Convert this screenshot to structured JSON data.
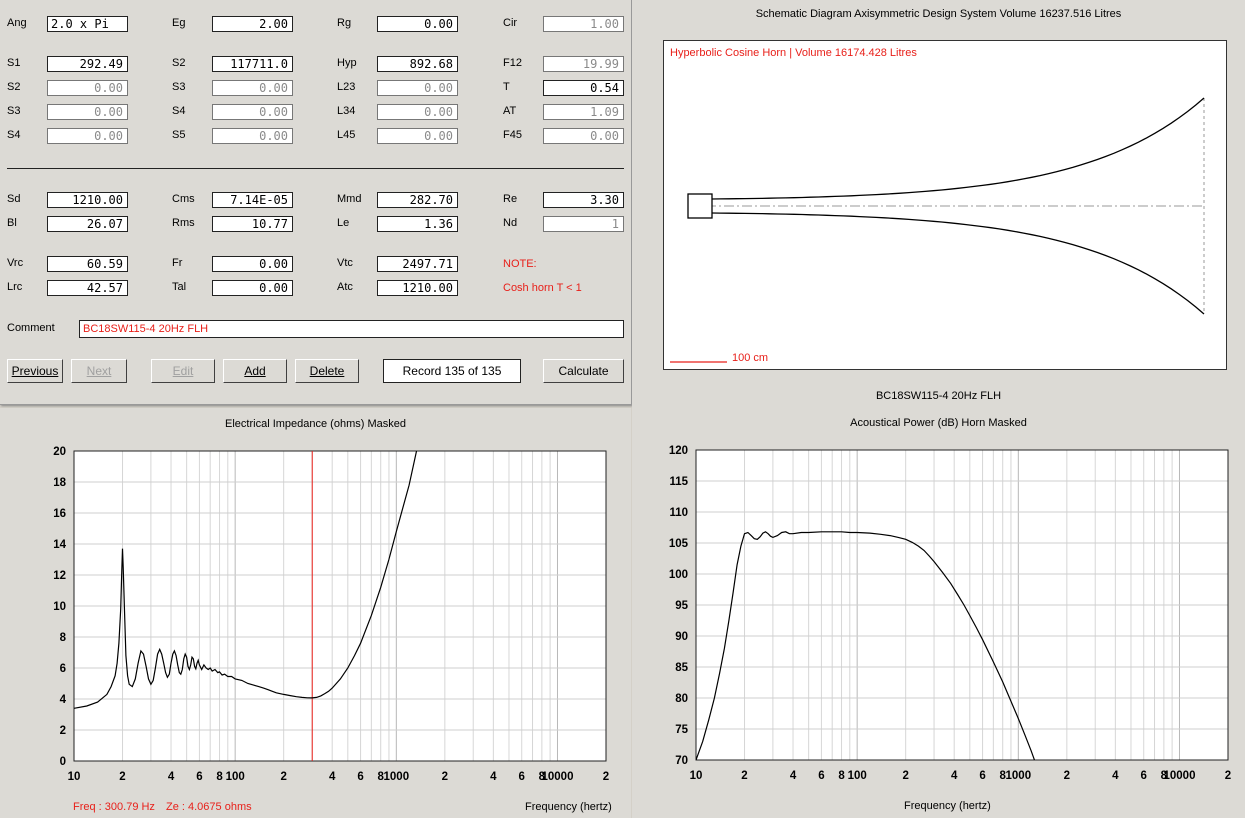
{
  "inputs": {
    "row1": [
      {
        "label": "Ang",
        "value": "2.0 x Pi",
        "align": "l",
        "dim": false
      },
      {
        "label": "Eg",
        "value": "2.00",
        "align": "r",
        "dim": false
      },
      {
        "label": "Rg",
        "value": "0.00",
        "align": "r",
        "dim": false
      },
      {
        "label": "Cir",
        "value": "1.00",
        "align": "r",
        "dim": true
      }
    ],
    "row2": [
      {
        "label": "S1",
        "value": "292.49",
        "dim": false
      },
      {
        "label": "S2",
        "value": "117711.0",
        "dim": false
      },
      {
        "label": "Hyp",
        "value": "892.68",
        "dim": false
      },
      {
        "label": "F12",
        "value": "19.99",
        "dim": true
      }
    ],
    "row3": [
      {
        "label": "S2",
        "value": "0.00",
        "dim": true
      },
      {
        "label": "S3",
        "value": "0.00",
        "dim": true
      },
      {
        "label": "L23",
        "value": "0.00",
        "dim": true
      },
      {
        "label": "T",
        "value": "0.54",
        "dim": false
      }
    ],
    "row4": [
      {
        "label": "S3",
        "value": "0.00",
        "dim": true
      },
      {
        "label": "S4",
        "value": "0.00",
        "dim": true
      },
      {
        "label": "L34",
        "value": "0.00",
        "dim": true
      },
      {
        "label": "AT",
        "value": "1.09",
        "dim": true
      }
    ],
    "row5": [
      {
        "label": "S4",
        "value": "0.00",
        "dim": true
      },
      {
        "label": "S5",
        "value": "0.00",
        "dim": true
      },
      {
        "label": "L45",
        "value": "0.00",
        "dim": true
      },
      {
        "label": "F45",
        "value": "0.00",
        "dim": true
      }
    ],
    "row6": [
      {
        "label": "Sd",
        "value": "1210.00",
        "dim": false
      },
      {
        "label": "Cms",
        "value": "7.14E-05",
        "dim": false
      },
      {
        "label": "Mmd",
        "value": "282.70",
        "dim": false
      },
      {
        "label": "Re",
        "value": "3.30",
        "dim": false
      }
    ],
    "row7": [
      {
        "label": "Bl",
        "value": "26.07",
        "dim": false
      },
      {
        "label": "Rms",
        "value": "10.77",
        "dim": false
      },
      {
        "label": "Le",
        "value": "1.36",
        "dim": false
      },
      {
        "label": "Nd",
        "value": "1",
        "dim": true
      }
    ],
    "row8": [
      {
        "label": "Vrc",
        "value": "60.59",
        "dim": false
      },
      {
        "label": "Fr",
        "value": "0.00",
        "dim": false
      },
      {
        "label": "Vtc",
        "value": "2497.71",
        "dim": false
      }
    ],
    "row9": [
      {
        "label": "Lrc",
        "value": "42.57",
        "dim": false
      },
      {
        "label": "Tal",
        "value": "0.00",
        "dim": false
      },
      {
        "label": "Atc",
        "value": "1210.00",
        "dim": false
      }
    ],
    "note_label": "NOTE:",
    "note_text": "Cosh horn  T < 1",
    "comment_label": "Comment",
    "comment_value": "BC18SW115-4  20Hz FLH",
    "buttons": {
      "previous": "Previous",
      "next": "Next",
      "edit": "Edit",
      "add": "Add",
      "delete": "Delete",
      "record": "Record 135 of 135",
      "calculate": "Calculate"
    }
  },
  "schematic": {
    "title": "Schematic Diagram   Axisymmetric Design   System Volume 16237.516 Litres",
    "horn_label": "Hyperbolic Cosine Horn | Volume 16174.428 Litres",
    "scale_label": "100 cm",
    "caption": "BC18SW115-4  20Hz FLH"
  },
  "impedance": {
    "title": "Electrical Impedance (ohms)   Masked",
    "readout_freq": "Freq : 300.79 Hz",
    "readout_ze": "Ze : 4.0675 ohms",
    "xlabel": "Frequency (hertz)"
  },
  "power": {
    "title": "Acoustical Power (dB)   Horn   Masked",
    "xlabel": "Frequency (hertz)"
  },
  "colors": {
    "curve": "#000000",
    "cursor": "#e8201a",
    "grid": "#c8c8c8",
    "note": "#e8201a"
  },
  "chart_data": [
    {
      "type": "line",
      "title": "Electrical Impedance (ohms)   Masked",
      "xlabel": "Frequency (hertz)",
      "ylabel": "",
      "xscale": "log",
      "xlim": [
        10,
        20000
      ],
      "ylim": [
        0,
        20
      ],
      "yticks": [
        0,
        2,
        4,
        6,
        8,
        10,
        12,
        14,
        16,
        18,
        20
      ],
      "xtick_labels": [
        "10",
        "2",
        "4",
        "6",
        "8",
        "100",
        "2",
        "4",
        "6",
        "8",
        "1000",
        "2",
        "4",
        "6",
        "8",
        "10000",
        "2"
      ],
      "cursor_x": 300.79,
      "series": [
        {
          "x": [
            10,
            12,
            14,
            16,
            17,
            18,
            18.5,
            19,
            19.5,
            19.8,
            20,
            20.2,
            20.6,
            21,
            21.5,
            22,
            23,
            24,
            25,
            26,
            27,
            28,
            29,
            30,
            31,
            32,
            33,
            34,
            35,
            36,
            37,
            38,
            39,
            40,
            41,
            42,
            43,
            44,
            45,
            46,
            47,
            48,
            49,
            50,
            51,
            52,
            53,
            54,
            55,
            56,
            57,
            58,
            59,
            60,
            62,
            64,
            66,
            68,
            70,
            72,
            75,
            78,
            80,
            83,
            86,
            90,
            95,
            100,
            110,
            120,
            130,
            140,
            150,
            160,
            170,
            180,
            200,
            220,
            240,
            260,
            280,
            300,
            320,
            340,
            360,
            380,
            400,
            450,
            500,
            550,
            600,
            700,
            800,
            900,
            1000,
            1200,
            1400,
            1600,
            1800,
            2000,
            2200,
            2400
          ],
          "y": [
            3.4,
            3.55,
            3.8,
            4.3,
            4.8,
            5.5,
            6.3,
            7.6,
            9.8,
            12.3,
            13.7,
            12.5,
            9.5,
            6.8,
            5.5,
            4.95,
            4.8,
            5.3,
            6.3,
            7.1,
            6.9,
            6.1,
            5.3,
            4.95,
            5.2,
            6.0,
            6.9,
            7.2,
            6.9,
            6.3,
            5.7,
            5.4,
            5.6,
            6.3,
            6.9,
            7.1,
            6.8,
            6.2,
            5.7,
            5.6,
            5.9,
            6.6,
            6.9,
            6.7,
            6.1,
            5.9,
            6.2,
            6.7,
            6.6,
            6.1,
            5.95,
            6.3,
            6.5,
            6.2,
            5.9,
            6.2,
            6.0,
            5.9,
            6.0,
            5.8,
            5.9,
            5.7,
            5.75,
            5.55,
            5.6,
            5.45,
            5.45,
            5.3,
            5.2,
            5.0,
            4.9,
            4.8,
            4.7,
            4.6,
            4.5,
            4.4,
            4.3,
            4.22,
            4.15,
            4.1,
            4.08,
            4.07,
            4.1,
            4.2,
            4.35,
            4.5,
            4.7,
            5.3,
            6.0,
            6.8,
            7.6,
            9.4,
            11.2,
            13.0,
            14.8,
            17.8,
            21.0,
            24.0,
            27.0,
            30.0,
            33.0,
            36.0
          ],
          "color": "#000000"
        }
      ]
    },
    {
      "type": "line",
      "title": "Acoustical Power (dB)   Horn   Masked",
      "xlabel": "Frequency (hertz)",
      "ylabel": "",
      "xscale": "log",
      "xlim": [
        10,
        20000
      ],
      "ylim": [
        70,
        120
      ],
      "yticks": [
        70,
        75,
        80,
        85,
        90,
        95,
        100,
        105,
        110,
        115,
        120
      ],
      "xtick_labels": [
        "10",
        "2",
        "4",
        "6",
        "8",
        "100",
        "2",
        "4",
        "6",
        "8",
        "1000",
        "2",
        "4",
        "6",
        "8",
        "10000",
        "2"
      ],
      "series": [
        {
          "x": [
            10,
            11,
            12,
            13,
            14,
            15,
            16,
            17,
            18,
            19,
            20,
            21,
            22,
            23,
            24,
            25,
            26,
            27,
            28,
            29,
            30,
            32,
            34,
            36,
            38,
            40,
            45,
            50,
            60,
            70,
            80,
            90,
            100,
            120,
            140,
            160,
            180,
            200,
            220,
            240,
            260,
            280,
            300,
            340,
            380,
            420,
            460,
            500,
            550,
            600,
            700,
            800,
            900,
            1000,
            1100,
            1200,
            1300
          ],
          "y": [
            70,
            73,
            76.5,
            80,
            84,
            88,
            92.5,
            97,
            101.5,
            104.5,
            106.5,
            106.7,
            106.2,
            105.7,
            105.6,
            106.0,
            106.6,
            106.8,
            106.5,
            106.1,
            105.9,
            106.2,
            106.7,
            106.8,
            106.5,
            106.5,
            106.7,
            106.7,
            106.8,
            106.8,
            106.8,
            106.7,
            106.7,
            106.6,
            106.4,
            106.2,
            105.9,
            105.6,
            105.1,
            104.5,
            103.8,
            102.9,
            102.0,
            100.2,
            98.5,
            96.7,
            95.0,
            93.3,
            91.3,
            89.4,
            85.8,
            82.6,
            79.5,
            76.7,
            74.0,
            71.5,
            69.0
          ],
          "color": "#000000"
        }
      ]
    }
  ]
}
